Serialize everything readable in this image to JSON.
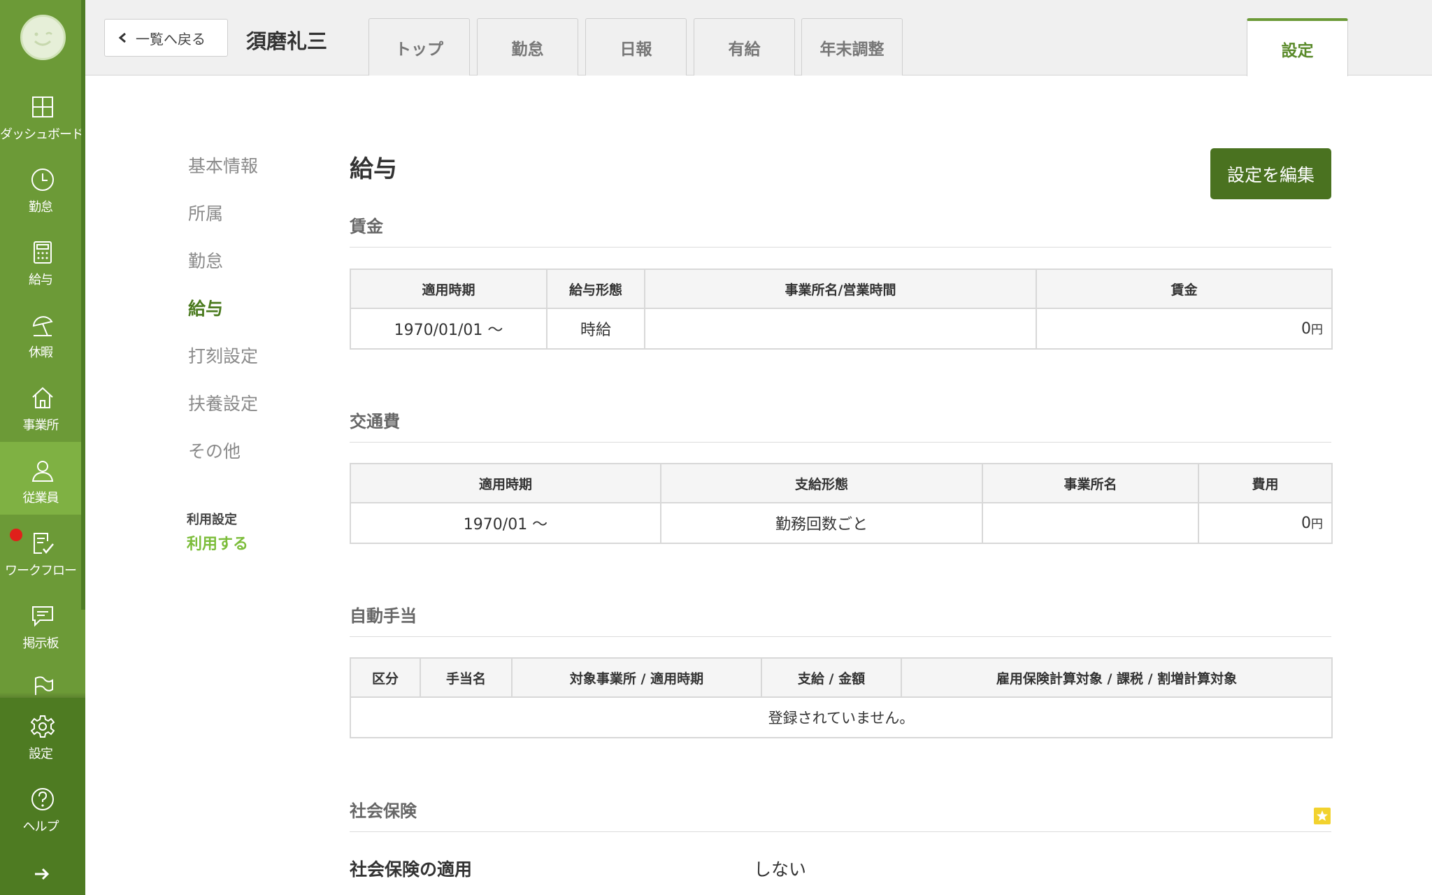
{
  "sidebar": {
    "items": [
      {
        "label": "ダッシュボード",
        "icon": "dashboard-icon"
      },
      {
        "label": "勤怠",
        "icon": "clock-icon"
      },
      {
        "label": "給与",
        "icon": "calculator-icon"
      },
      {
        "label": "休暇",
        "icon": "umbrella-icon"
      },
      {
        "label": "事業所",
        "icon": "home-icon"
      },
      {
        "label": "従業員",
        "icon": "person-icon"
      },
      {
        "label": "ワークフロー",
        "icon": "checklist-icon"
      },
      {
        "label": "掲示板",
        "icon": "chat-icon"
      },
      {
        "label": "",
        "icon": "flag-icon"
      }
    ],
    "bottom_items": [
      {
        "label": "設定",
        "icon": "gear-icon"
      },
      {
        "label": "ヘルプ",
        "icon": "help-icon"
      }
    ],
    "active": "従業員",
    "colors": {
      "background": "#6c9a37",
      "active": "#7fb143",
      "bottom": "#4e7b22",
      "notification": "#e0201a"
    }
  },
  "header": {
    "back_label": "一覧へ戻る",
    "employee_name": "須磨礼三",
    "tabs": [
      "トップ",
      "勤怠",
      "日報",
      "有給",
      "年末調整"
    ],
    "settings_tab": "設定"
  },
  "subnav": {
    "items": [
      "基本情報",
      "所属",
      "勤怠",
      "給与",
      "打刻設定",
      "扶養設定",
      "その他"
    ],
    "active": "給与",
    "usage_label": "利用設定",
    "usage_value": "利用する"
  },
  "main": {
    "title": "給与",
    "edit_button": "設定を編集",
    "wage": {
      "heading": "賃金",
      "columns": [
        "適用時期",
        "給与形態",
        "事業所名/営業時間",
        "賃金"
      ],
      "rows": [
        {
          "period": "1970/01/01 〜",
          "type": "時給",
          "office": "",
          "amount": "0",
          "unit": "円"
        }
      ]
    },
    "transport": {
      "heading": "交通費",
      "columns": [
        "適用時期",
        "支給形態",
        "事業所名",
        "費用"
      ],
      "rows": [
        {
          "period": "1970/01 〜",
          "type": "勤務回数ごと",
          "office": "",
          "amount": "0",
          "unit": "円"
        }
      ]
    },
    "allowance": {
      "heading": "自動手当",
      "columns": [
        "区分",
        "手当名",
        "対象事業所 / 適用時期",
        "支給 / 金額",
        "雇用保険計算対象 / 課税 / 割増計算対象"
      ],
      "empty_message": "登録されていません。"
    },
    "social_insurance": {
      "heading": "社会保険",
      "label": "社会保険の適用",
      "value": "しない"
    }
  }
}
